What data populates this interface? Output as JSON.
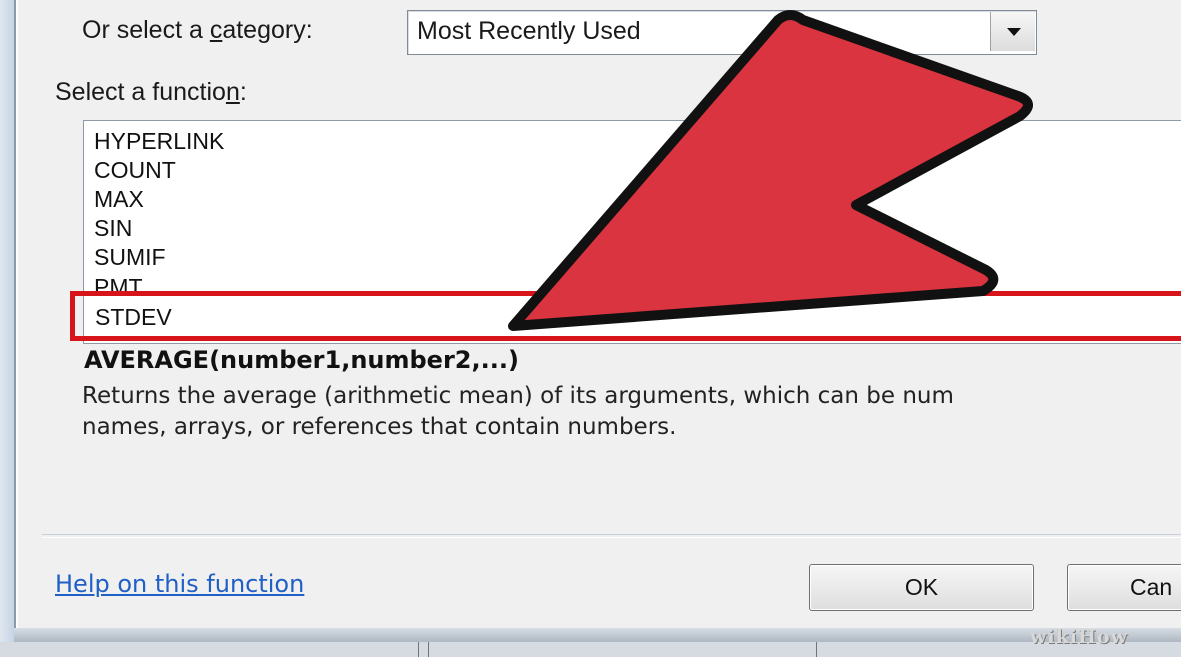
{
  "dialog": {
    "category_label_pre": "Or select a ",
    "category_label_key": "c",
    "category_label_post": "ategory:",
    "category_value": "Most Recently Used",
    "function_label_pre": "Select a functio",
    "function_label_key": "n",
    "function_label_post": ":",
    "functions": [
      "HYPERLINK",
      "COUNT",
      "MAX",
      "SIN",
      "SUMIF",
      "PMT"
    ],
    "selected_function": "STDEV",
    "syntax": "AVERAGE(number1,number2,...)",
    "description_line1": "Returns the average (arithmetic mean) of its arguments, which can be num",
    "description_line2": "names, arrays, or references that contain numbers.",
    "help_link": "Help on this function",
    "ok_label": "OK",
    "cancel_label": "Can"
  },
  "overlay": {
    "arrow_color": "#d9343f",
    "highlight_color": "#d8141b"
  },
  "watermark": "wikiHow"
}
